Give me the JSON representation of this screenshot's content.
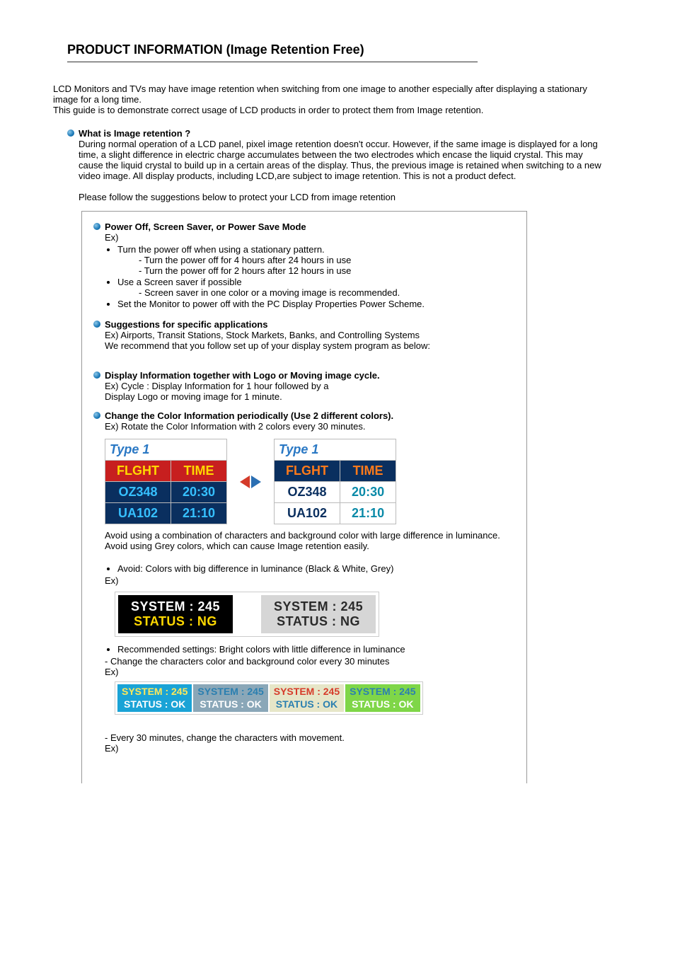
{
  "title": "PRODUCT INFORMATION (Image Retention Free)",
  "intro": {
    "p1": "LCD Monitors and TVs may have image retention when switching from one image to another especially after displaying a stationary image for a long time.",
    "p2": "This guide is to demonstrate correct usage of LCD products in order to protect them from Image retention."
  },
  "whatIs": {
    "heading": "What is Image retention ?",
    "body": "During normal operation of a LCD panel, pixel image retention doesn't occur. However, if the same image is displayed for a long time, a slight difference in electric charge accumulates between the two electrodes which encase the liquid crystal. This may cause the liquid crystal to build up in a certain areas of the display. Thus, the previous image is retained when switching to a new video image. All display products, including LCD,are subject to image retention. This is not a product defect.",
    "follow": "Please follow the suggestions below to protect your LCD from image retention"
  },
  "box": {
    "powerOff": {
      "heading": "Power Off, Screen Saver, or Power Save Mode",
      "ex": "Ex)",
      "b1": "Turn the power off when using a stationary pattern.",
      "b1s1": "- Turn the power off for 4 hours after 24 hours in use",
      "b1s2": "- Turn the power off for 2 hours after 12 hours in use",
      "b2": "Use a Screen saver if possible",
      "b2s1": "- Screen saver in one color or a moving image is recommended.",
      "b3": "Set the Monitor to power off with the PC Display Properties Power Scheme."
    },
    "suggestions": {
      "heading": "Suggestions for specific applications",
      "l1": "Ex) Airports, Transit Stations, Stock Markets, Banks, and Controlling Systems",
      "l2": "We recommend that you follow set up of your display system program as below:"
    },
    "displayInfo": {
      "heading": "Display Information together with Logo or Moving image cycle.",
      "l1": "Ex) Cycle : Display Information for 1 hour followed by a",
      "l2": "Display Logo or moving image for 1 minute."
    },
    "changeColor": {
      "heading": "Change the Color Information periodically (Use 2 different colors).",
      "l1": "Ex) Rotate the Color Information with 2 colors every 30 minutes."
    },
    "flight": {
      "caption": "Type 1",
      "h1": "FLGHT",
      "h2": "TIME",
      "rows": [
        {
          "c1": "OZ348",
          "c2": "20:30"
        },
        {
          "c1": "UA102",
          "c2": "21:10"
        }
      ],
      "left": {
        "hbg": "#c71f1f",
        "hfg": "#ffd800",
        "bg": "#0a2f5f",
        "fg": "#36c0ff"
      },
      "right": {
        "hbg": "#0a2f5f",
        "hfg": "#ff7a1a",
        "bg": "#ffffff",
        "c1fg": "#0a2f5f",
        "c2fg": "#0a8aa8"
      }
    },
    "avoid": {
      "p1": "Avoid using a combination of characters and background color with large difference in luminance.",
      "p2": "Avoid using Grey colors, which can cause Image retention easily.",
      "b1": "Avoid: Colors with big difference in luminance (Black & White, Grey)",
      "ex": "Ex)"
    },
    "sys": {
      "line1": "SYSTEM : 245",
      "line2": "STATUS : NG",
      "left": {
        "bg": "#000000",
        "c1": "#ffffff",
        "c2": "#ffd800"
      },
      "right": {
        "bg": "#d6d6d6",
        "c1": "#2a2a2a",
        "c2": "#2a2a2a"
      }
    },
    "rec": {
      "b1": "Recommended settings: Bright colors with little difference in luminance",
      "l1": "- Change the characters color and background color every 30 minutes",
      "ex": "Ex)"
    },
    "ok": {
      "line1": "SYSTEM : 245",
      "line2": "STATUS : OK",
      "boxes": [
        {
          "bg": "#1aa3d6",
          "c1": "#ffe85a",
          "c2": "#ffffff"
        },
        {
          "bg": "#8aa7b8",
          "c1": "#2a7fb0",
          "c2": "#ffffff"
        },
        {
          "bg": "#e6e6c8",
          "c1": "#d63b2a",
          "c2": "#2a7fb0"
        },
        {
          "bg": "#7fd648",
          "c1": "#2a7fb0",
          "c2": "#ffffff"
        }
      ]
    },
    "move": {
      "l1": "- Every 30 minutes, change the characters with movement.",
      "ex": "Ex)"
    }
  }
}
